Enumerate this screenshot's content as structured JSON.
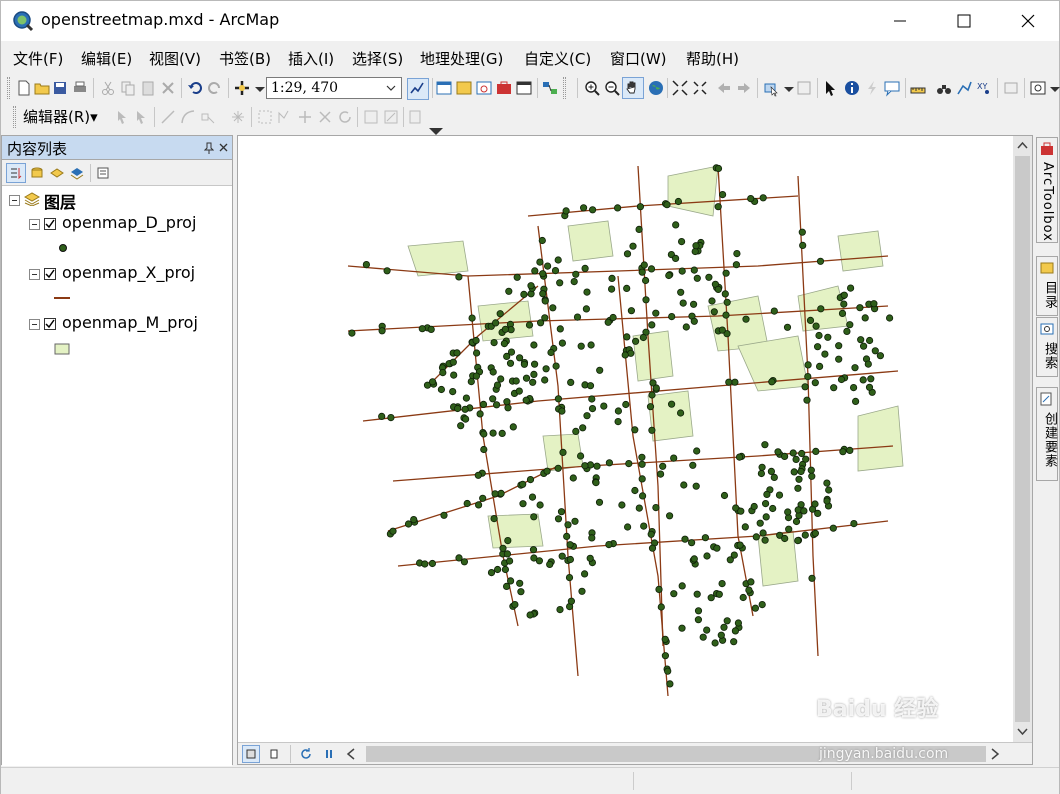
{
  "window": {
    "title": "openstreetmap.mxd - ArcMap"
  },
  "menu": [
    "文件(F)",
    "编辑(E)",
    "视图(V)",
    "书签(B)",
    "插入(I)",
    "选择(S)",
    "地理处理(G)",
    "自定义(C)",
    "窗口(W)",
    "帮助(H)"
  ],
  "toolbar": {
    "scale": "1:29, 470",
    "editor_label": "编辑器(R)▾"
  },
  "toc": {
    "title": "内容列表",
    "root_label": "图层",
    "layers": [
      {
        "name": "openmap_D_proj",
        "checked": true,
        "symbol": "point"
      },
      {
        "name": "openmap_X_proj",
        "checked": true,
        "symbol": "line"
      },
      {
        "name": "openmap_M_proj",
        "checked": true,
        "symbol": "polygon"
      }
    ]
  },
  "side_tabs": [
    "ArcToolbox",
    "目录",
    "搜索",
    "创建要素"
  ],
  "colors": {
    "point_fill": "#2f5f1a",
    "line": "#8b3a14",
    "polygon_fill": "#e4f2c4",
    "polygon_stroke": "#9aa88a",
    "toc_header": "#c7daf0"
  },
  "watermark": {
    "brand": "Baidu 经验",
    "url": "jingyan.baidu.com"
  }
}
